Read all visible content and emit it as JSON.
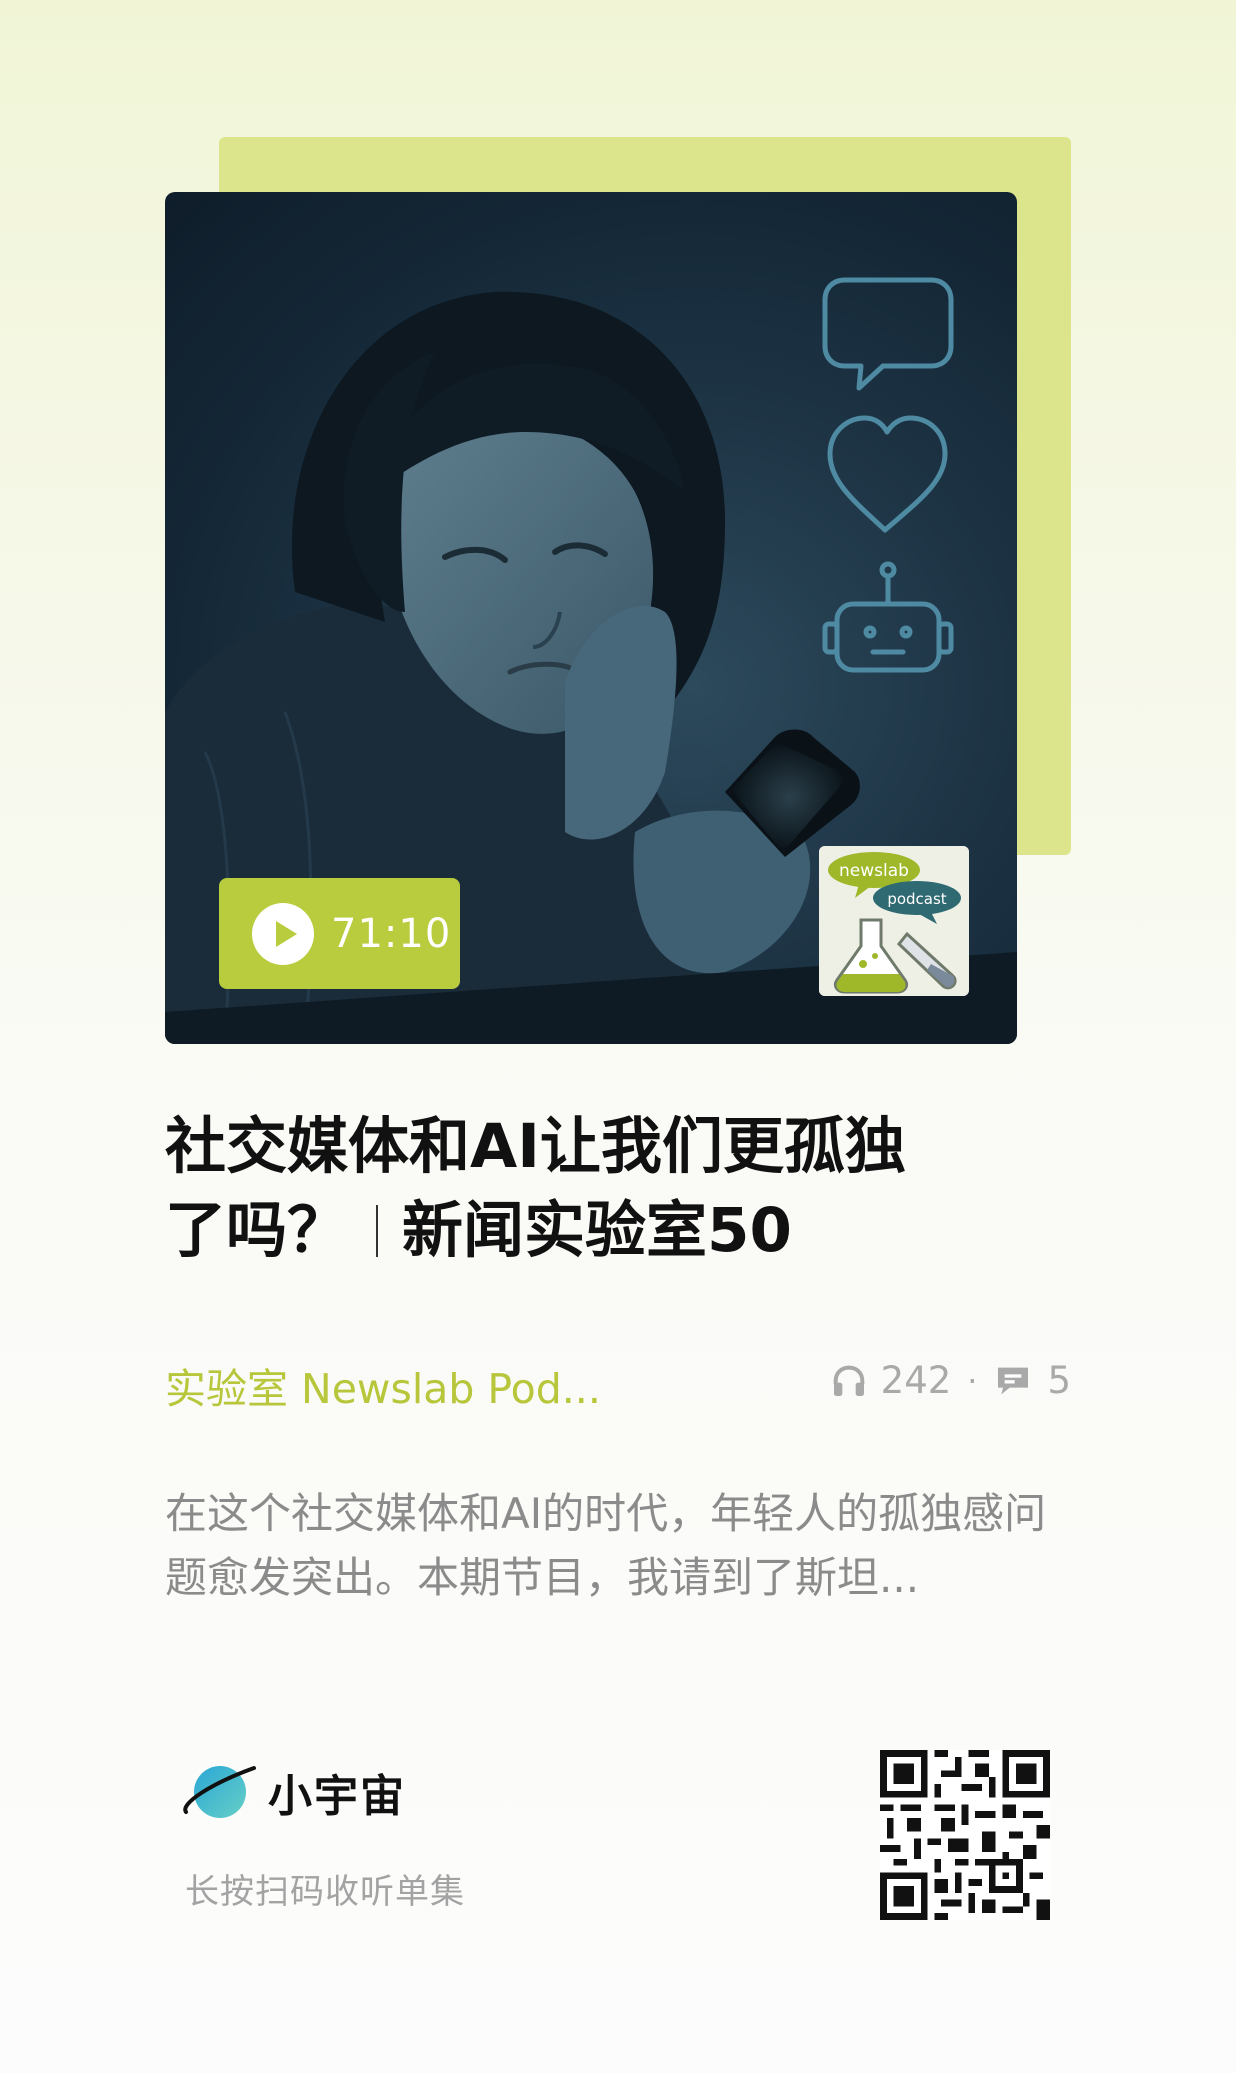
{
  "episode": {
    "title_line1": "社交媒体和AI让我们更孤独",
    "title_line2a": "了吗？",
    "title_line2b": "新闻实验室50",
    "duration": "71:10",
    "podcast_name": "实验室 Newslab Pod...",
    "plays": "242",
    "comments": "5",
    "description": "在这个社交媒体和AI的时代，年轻人的孤独感问题愈发突出。本期节目，我请到了斯坦..."
  },
  "cover": {
    "badge_text_1": "newslab",
    "badge_text_2": "podcast"
  },
  "footer": {
    "brand_name": "小宇宙",
    "hint": "长按扫码收听单集"
  },
  "colors": {
    "accent": "#b8cc3d",
    "accent_text": "#b7c63a",
    "backplate": "#dde58c",
    "cover_bg": "#142736",
    "neon_icon": "#4f8aa3"
  }
}
